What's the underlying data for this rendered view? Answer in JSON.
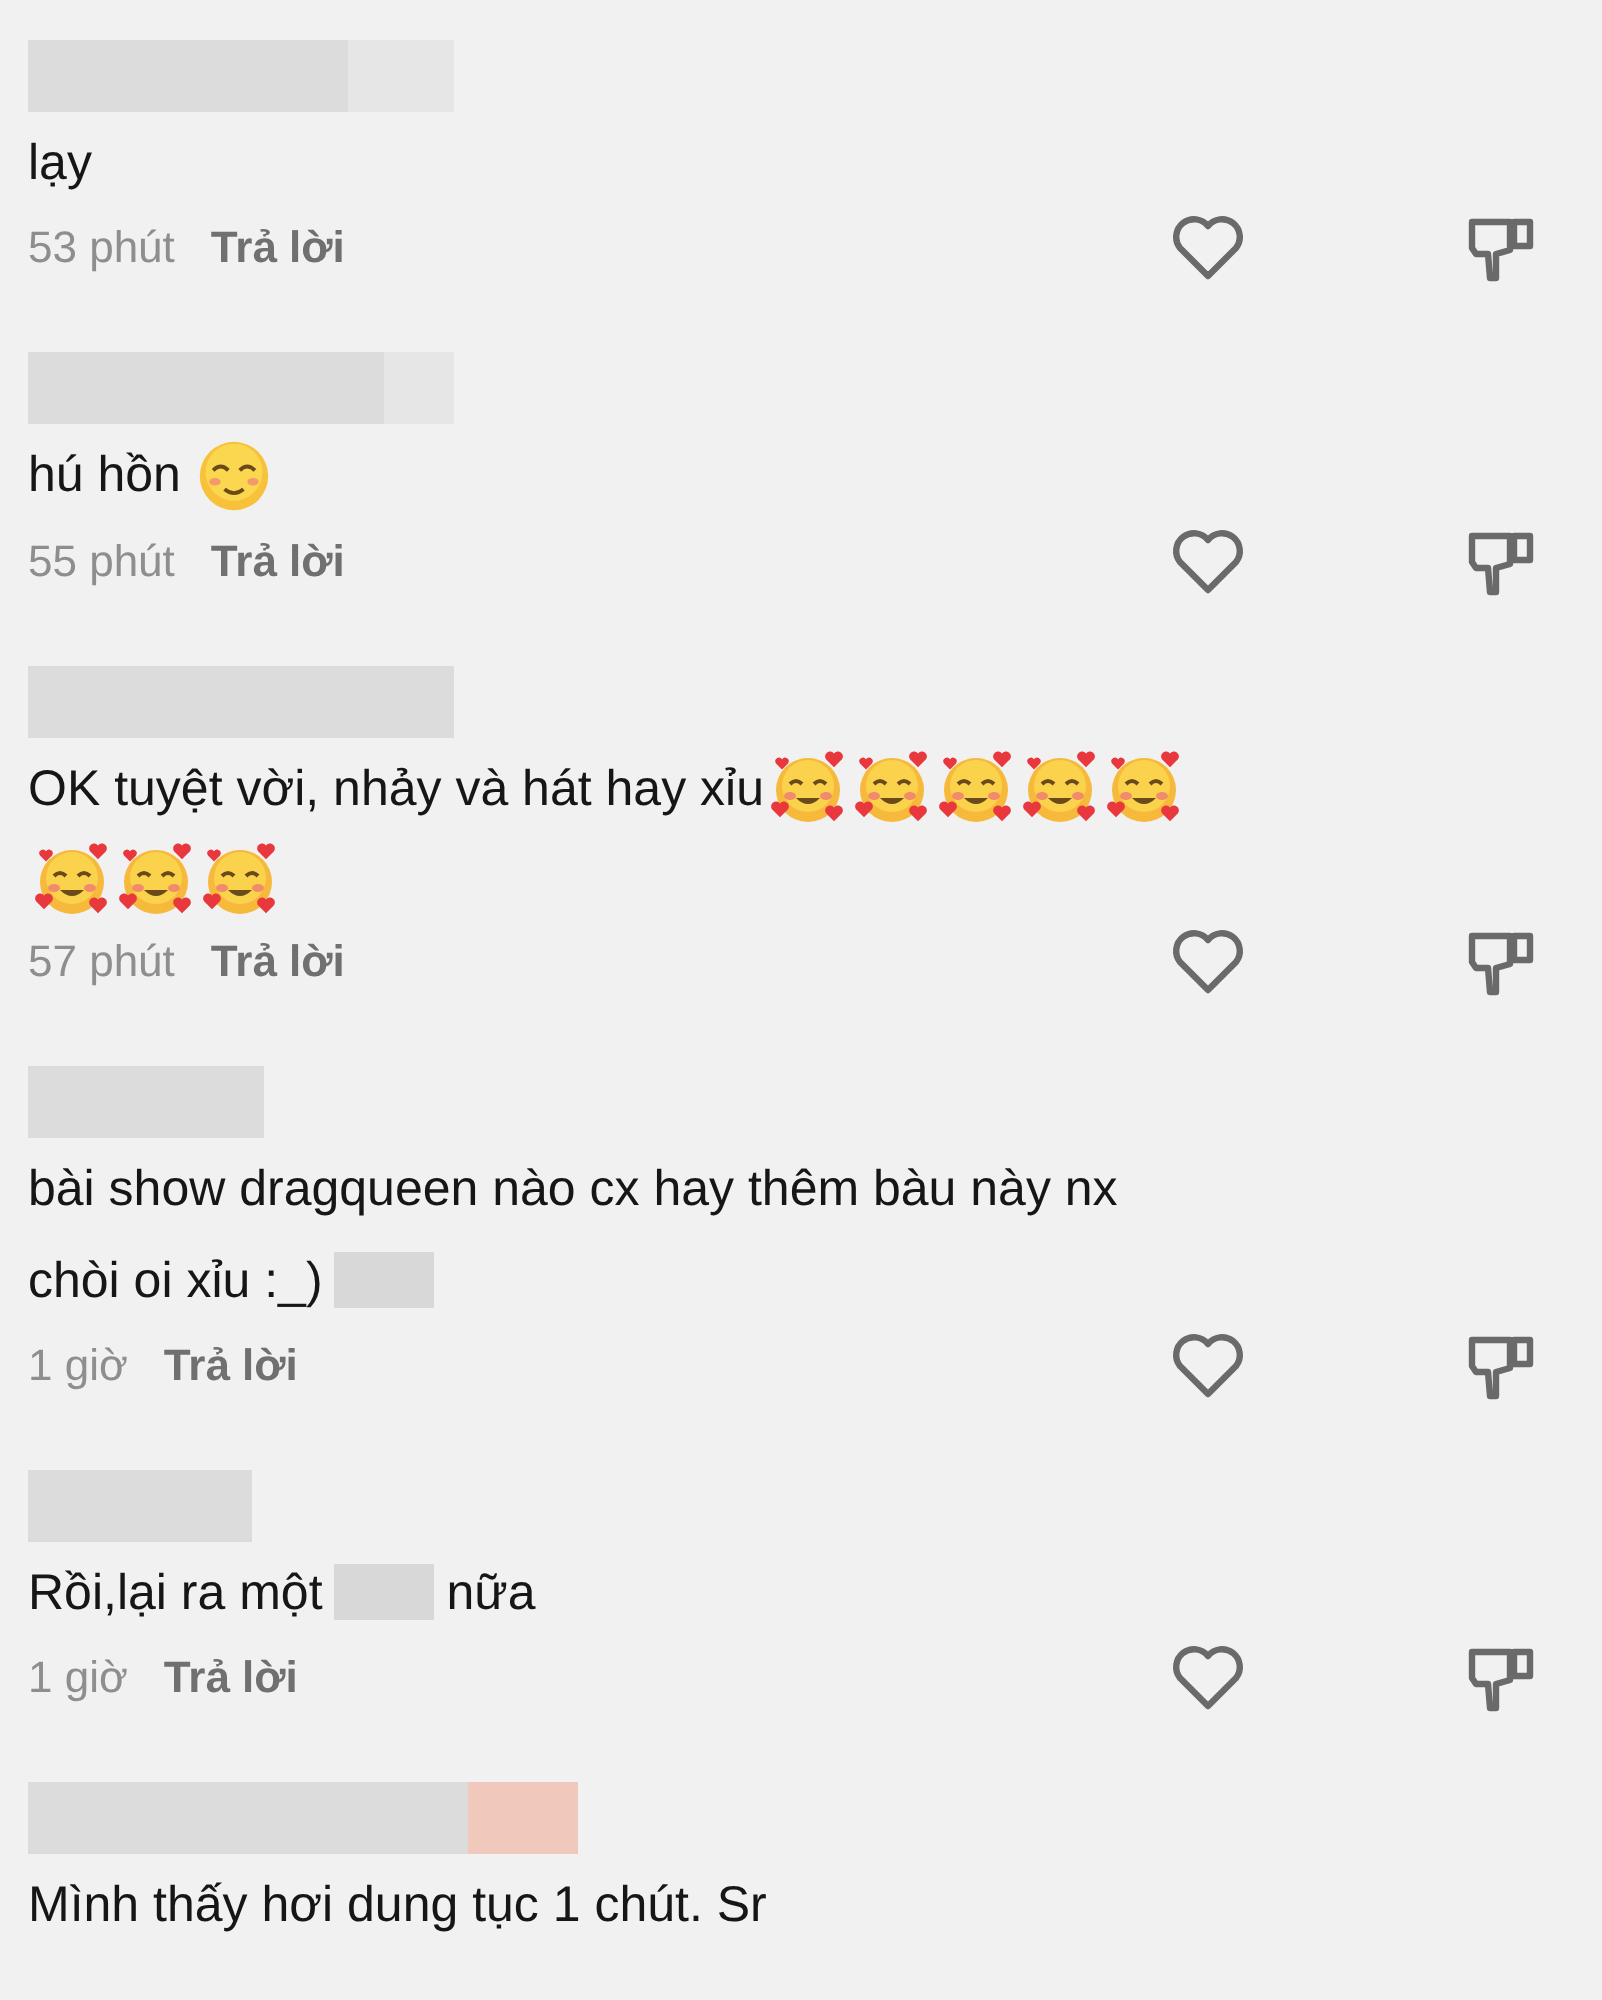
{
  "comments": [
    {
      "author": {
        "redacted": true
      },
      "lines": [
        [
          {
            "kind": "text",
            "text": "lạy"
          }
        ]
      ],
      "time": "53 phút",
      "reply": "Trả lời",
      "liked": false
    },
    {
      "author": {
        "redacted": true
      },
      "lines": [
        [
          {
            "kind": "text",
            "text": "hú hồn"
          },
          {
            "kind": "relieved-emoji"
          }
        ]
      ],
      "time": "55 phút",
      "reply": "Trả lời",
      "liked": false
    },
    {
      "author": {
        "redacted": true
      },
      "lines": [
        [
          {
            "kind": "text",
            "text": "OK tuyệt vời, nhảy và hát hay xỉu"
          },
          {
            "kind": "hearts-emoji"
          },
          {
            "kind": "hearts-emoji"
          },
          {
            "kind": "hearts-emoji"
          },
          {
            "kind": "hearts-emoji"
          },
          {
            "kind": "hearts-emoji"
          }
        ],
        [
          {
            "kind": "hearts-emoji"
          },
          {
            "kind": "hearts-emoji"
          },
          {
            "kind": "hearts-emoji"
          }
        ]
      ],
      "time": "57 phút",
      "reply": "Trả lời",
      "liked": false
    },
    {
      "author": {
        "redacted": true
      },
      "lines": [
        [
          {
            "kind": "text",
            "text": "bài show dragqueen nào cx hay thêm bàu này nx"
          }
        ],
        [
          {
            "kind": "text",
            "text": "chòi oi xỉu :_)"
          },
          {
            "kind": "redaction"
          }
        ]
      ],
      "time": "1 giờ",
      "reply": "Trả lời",
      "liked": false
    },
    {
      "author": {
        "redacted": true
      },
      "lines": [
        [
          {
            "kind": "text",
            "text": "Rồi,lại ra một"
          },
          {
            "kind": "redaction"
          },
          {
            "kind": "text",
            "text": "nữa"
          }
        ]
      ],
      "time": "1 giờ",
      "reply": "Trả lời",
      "liked": false
    },
    {
      "author": {
        "redacted": true
      },
      "lines": [
        [
          {
            "kind": "text",
            "text": "Mình thấy hơi dung tục 1 chút. Sr"
          }
        ]
      ]
    }
  ]
}
